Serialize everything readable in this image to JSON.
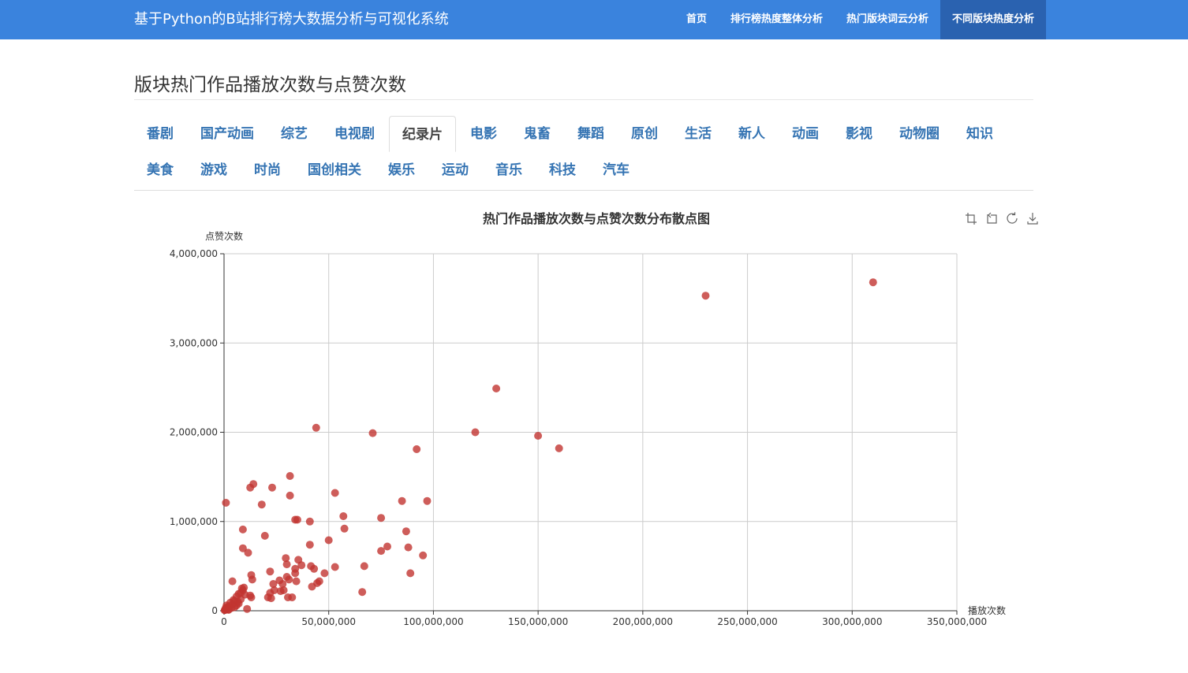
{
  "header": {
    "brand": "基于Python的B站排行榜大数据分析与可视化系统",
    "nav": [
      {
        "label": "首页",
        "name": "nav-home"
      },
      {
        "label": "排行榜热度整体分析",
        "name": "nav-overall-heat"
      },
      {
        "label": "热门版块词云分析",
        "name": "nav-wordcloud"
      },
      {
        "label": "不同版块热度分析",
        "name": "nav-section-heat",
        "active": true
      }
    ]
  },
  "page_title": "版块热门作品播放次数与点赞次数",
  "tabs": [
    "番剧",
    "国产动画",
    "综艺",
    "电视剧",
    "纪录片",
    "电影",
    "鬼畜",
    "舞蹈",
    "原创",
    "生活",
    "新人",
    "动画",
    "影视",
    "动物圈",
    "知识",
    "美食",
    "游戏",
    "时尚",
    "国创相关",
    "娱乐",
    "运动",
    "音乐",
    "科技",
    "汽车"
  ],
  "active_tab": "纪录片",
  "toolbox": [
    "zoom-icon",
    "zoom-reset-icon",
    "restore-icon",
    "download-icon"
  ],
  "colors": {
    "header": "#3a83dd",
    "nav_active": "#2a62b0",
    "tab_link": "#3574b3",
    "point": "#c23531"
  },
  "chart_data": {
    "type": "scatter",
    "title": "热门作品播放次数与点赞次数分布散点图",
    "xlabel": "播放次数",
    "ylabel": "点赞次数",
    "xlim": [
      0,
      350000000
    ],
    "ylim": [
      0,
      4000000
    ],
    "x_ticks": [
      "0",
      "50,000,000",
      "100,000,000",
      "150,000,000",
      "200,000,000",
      "250,000,000",
      "300,000,000",
      "350,000,000"
    ],
    "y_ticks": [
      "0",
      "1,000,000",
      "2,000,000",
      "3,000,000",
      "4,000,000"
    ],
    "grid": true,
    "points": [
      [
        310000000,
        3680000
      ],
      [
        230000000,
        3530000
      ],
      [
        130000000,
        2490000
      ],
      [
        120000000,
        2000000
      ],
      [
        150000000,
        1960000
      ],
      [
        160000000,
        1820000
      ],
      [
        92000000,
        1810000
      ],
      [
        71000000,
        1990000
      ],
      [
        44000000,
        2050000
      ],
      [
        31500000,
        1510000
      ],
      [
        14000000,
        1420000
      ],
      [
        12500000,
        1380000
      ],
      [
        23000000,
        1380000
      ],
      [
        31500000,
        1290000
      ],
      [
        53000000,
        1320000
      ],
      [
        85000000,
        1230000
      ],
      [
        97000000,
        1230000
      ],
      [
        900000,
        1210000
      ],
      [
        18000000,
        1190000
      ],
      [
        57000000,
        1060000
      ],
      [
        75000000,
        1040000
      ],
      [
        34000000,
        1020000
      ],
      [
        35000000,
        1020000
      ],
      [
        41000000,
        1000000
      ],
      [
        57500000,
        920000
      ],
      [
        9000000,
        910000
      ],
      [
        87000000,
        890000
      ],
      [
        19500000,
        840000
      ],
      [
        50000000,
        790000
      ],
      [
        41000000,
        740000
      ],
      [
        78000000,
        720000
      ],
      [
        88000000,
        710000
      ],
      [
        9000000,
        700000
      ],
      [
        11500000,
        650000
      ],
      [
        75000000,
        670000
      ],
      [
        95000000,
        620000
      ],
      [
        29500000,
        590000
      ],
      [
        35500000,
        570000
      ],
      [
        30000000,
        520000
      ],
      [
        37000000,
        510000
      ],
      [
        41500000,
        500000
      ],
      [
        53000000,
        490000
      ],
      [
        67000000,
        500000
      ],
      [
        34000000,
        470000
      ],
      [
        43000000,
        470000
      ],
      [
        22000000,
        440000
      ],
      [
        34000000,
        420000
      ],
      [
        48000000,
        420000
      ],
      [
        89000000,
        420000
      ],
      [
        13000000,
        400000
      ],
      [
        30000000,
        380000
      ],
      [
        13500000,
        350000
      ],
      [
        31000000,
        350000
      ],
      [
        26500000,
        340000
      ],
      [
        4000000,
        330000
      ],
      [
        34500000,
        330000
      ],
      [
        45500000,
        330000
      ],
      [
        23500000,
        300000
      ],
      [
        28000000,
        300000
      ],
      [
        44500000,
        310000
      ],
      [
        42000000,
        270000
      ],
      [
        8500000,
        250000
      ],
      [
        9000000,
        230000
      ],
      [
        24000000,
        230000
      ],
      [
        27000000,
        220000
      ],
      [
        66000000,
        210000
      ],
      [
        8000000,
        200000
      ],
      [
        22000000,
        200000
      ],
      [
        28500000,
        230000
      ],
      [
        7000000,
        190000
      ],
      [
        10000000,
        180000
      ],
      [
        12500000,
        170000
      ],
      [
        6000000,
        160000
      ],
      [
        13000000,
        150000
      ],
      [
        21000000,
        150000
      ],
      [
        22500000,
        140000
      ],
      [
        30500000,
        150000
      ],
      [
        32500000,
        150000
      ],
      [
        8000000,
        130000
      ],
      [
        5000000,
        110000
      ],
      [
        6500000,
        100000
      ],
      [
        3000000,
        90000
      ],
      [
        7000000,
        80000
      ],
      [
        4000000,
        70000
      ],
      [
        6000000,
        60000
      ],
      [
        2500000,
        50000
      ],
      [
        1500000,
        40000
      ],
      [
        5000000,
        40000
      ],
      [
        3500000,
        30000
      ],
      [
        11000000,
        20000
      ],
      [
        1000000,
        20000
      ],
      [
        2000000,
        15000
      ],
      [
        500000,
        10000
      ],
      [
        300000,
        5000
      ],
      [
        800000,
        30000
      ],
      [
        1200000,
        60000
      ],
      [
        4500000,
        120000
      ],
      [
        9500000,
        260000
      ],
      [
        2200000,
        10000
      ],
      [
        600000,
        15000
      ]
    ]
  }
}
